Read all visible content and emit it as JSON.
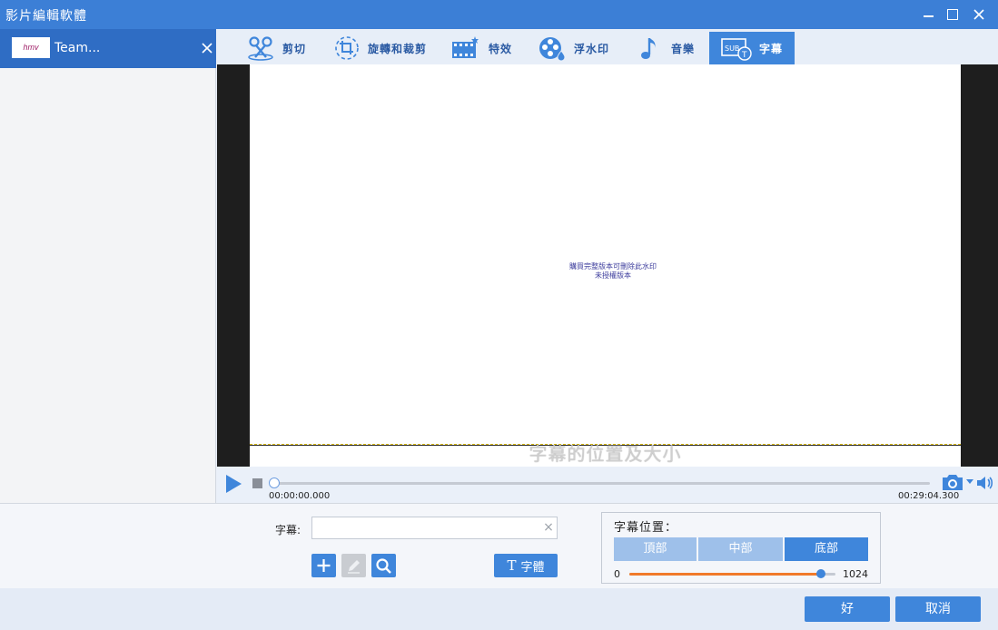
{
  "window": {
    "title": "影片編輯軟體"
  },
  "media": {
    "thumb_text": "hmv",
    "name": "Team..."
  },
  "tabs": [
    {
      "label": "剪切",
      "icon": "scissors-icon"
    },
    {
      "label": "旋轉和裁剪",
      "icon": "crop-rotate-icon"
    },
    {
      "label": "特效",
      "icon": "effects-icon"
    },
    {
      "label": "浮水印",
      "icon": "watermark-icon"
    },
    {
      "label": "音樂",
      "icon": "music-note-icon"
    },
    {
      "label": "字幕",
      "icon": "subtitle-icon",
      "active": true
    }
  ],
  "preview": {
    "watermark_line1": "購買完整版本可刪除此水印",
    "watermark_line2": "未授權版本",
    "subtitle_text": "字幕的位置及大小"
  },
  "playback": {
    "time_start": "00:00:00.000",
    "time_end": "00:29:04.300",
    "progress": 0
  },
  "subtitle_editor": {
    "label": "字幕:",
    "input_value": "",
    "input_placeholder": "",
    "clear_symbol": "×",
    "font_button_icon": "T",
    "font_button_label": "字體"
  },
  "position": {
    "title": "字幕位置：",
    "top_label": "頂部",
    "middle_label": "中部",
    "bottom_label": "底部",
    "selected": "bottom",
    "slider_min": "0",
    "slider_max": "1024",
    "slider_value_fraction": 0.93
  },
  "footer": {
    "ok_label": "好",
    "cancel_label": "取消"
  },
  "colors": {
    "accent": "#3f86db",
    "titlebar": "#3c7fd6",
    "slider_fill": "#f07a2a"
  }
}
